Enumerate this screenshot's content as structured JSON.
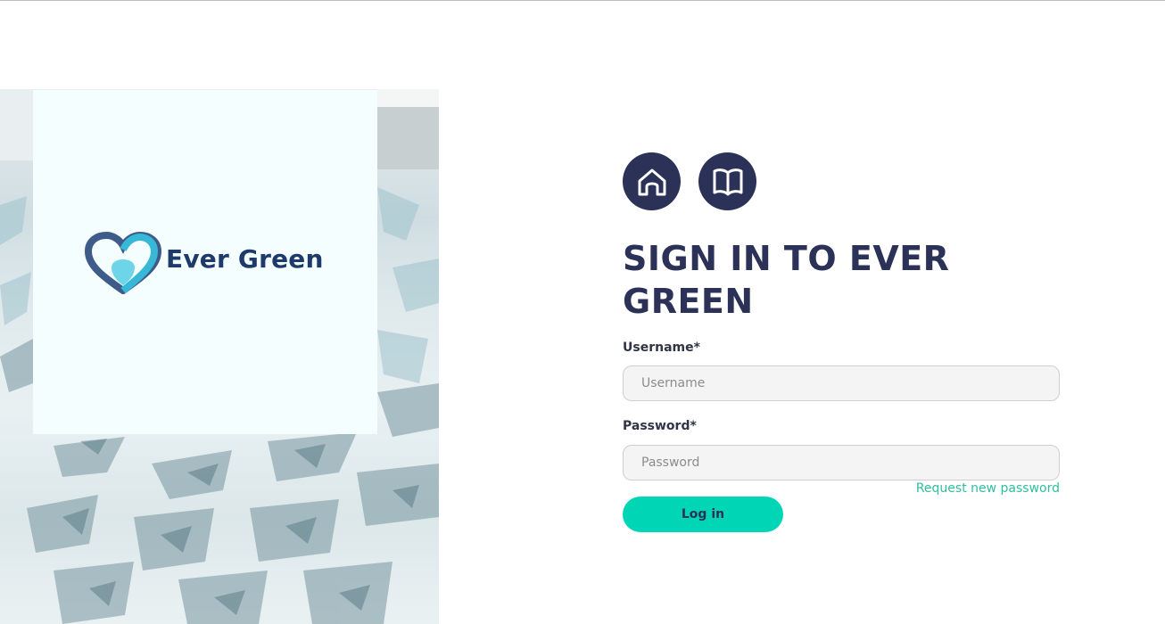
{
  "brand": {
    "name": "Ever Green",
    "colors": {
      "navy": "#2b3157",
      "accent": "#00d6b5",
      "link": "#2fbf9f",
      "logo_text": "#1d3a6b"
    }
  },
  "nav": {
    "home_icon": "home-icon",
    "docs_icon": "book-icon"
  },
  "login": {
    "title": "SIGN IN TO EVER GREEN",
    "username_label": "Username*",
    "username_placeholder": "Username",
    "username_value": "",
    "password_label": "Password*",
    "password_placeholder": "Password",
    "password_value": "",
    "request_password": "Request new password",
    "submit_label": "Log in"
  }
}
